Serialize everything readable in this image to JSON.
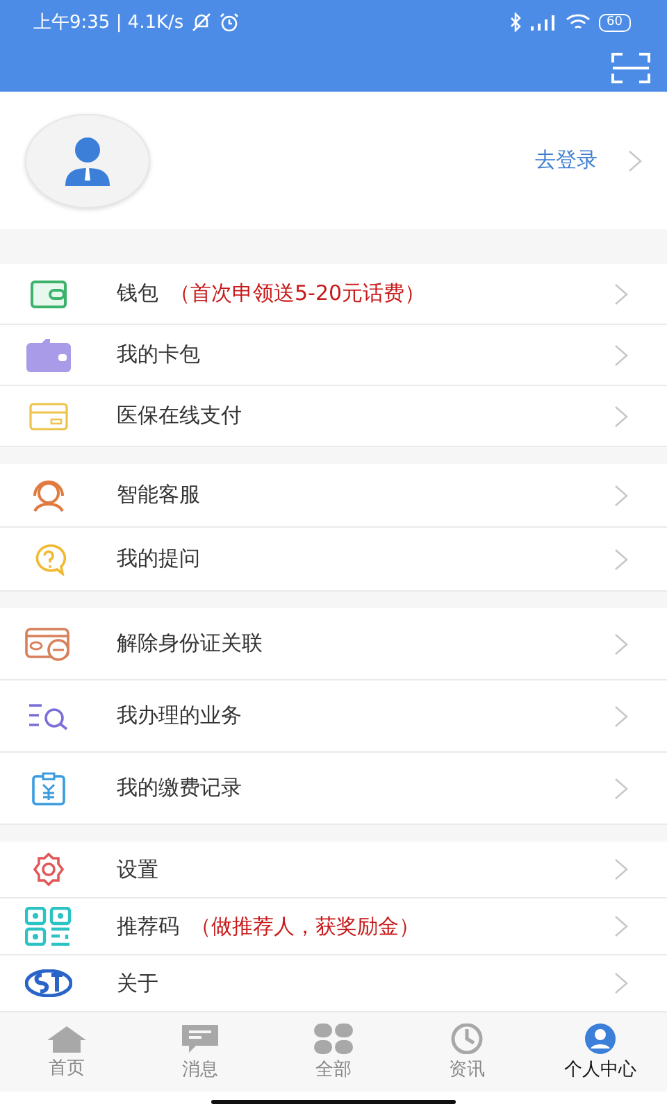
{
  "status_bar": {
    "time": "上午9:35 | 4.1K/s",
    "battery": "60"
  },
  "profile": {
    "login": "去登录"
  },
  "groups": [
    {
      "items": [
        {
          "label": "钱包",
          "note": "（首次申领送5-20元话费）"
        },
        {
          "label": "我的卡包"
        },
        {
          "label": "医保在线支付"
        }
      ]
    },
    {
      "items": [
        {
          "label": "智能客服"
        },
        {
          "label": "我的提问"
        }
      ]
    },
    {
      "items": [
        {
          "label": "解除身份证关联"
        },
        {
          "label": "我办理的业务"
        },
        {
          "label": "我的缴费记录"
        }
      ]
    },
    {
      "items": [
        {
          "label": "设置"
        },
        {
          "label": "推荐码",
          "note": "（做推荐人，获奖励金）"
        },
        {
          "label": "关于"
        }
      ]
    }
  ],
  "tabs": [
    {
      "label": "首页",
      "selected": false
    },
    {
      "label": "消息",
      "selected": false
    },
    {
      "label": "全部",
      "selected": false
    },
    {
      "label": "资讯",
      "selected": false
    },
    {
      "label": "个人中心",
      "selected": true
    }
  ]
}
